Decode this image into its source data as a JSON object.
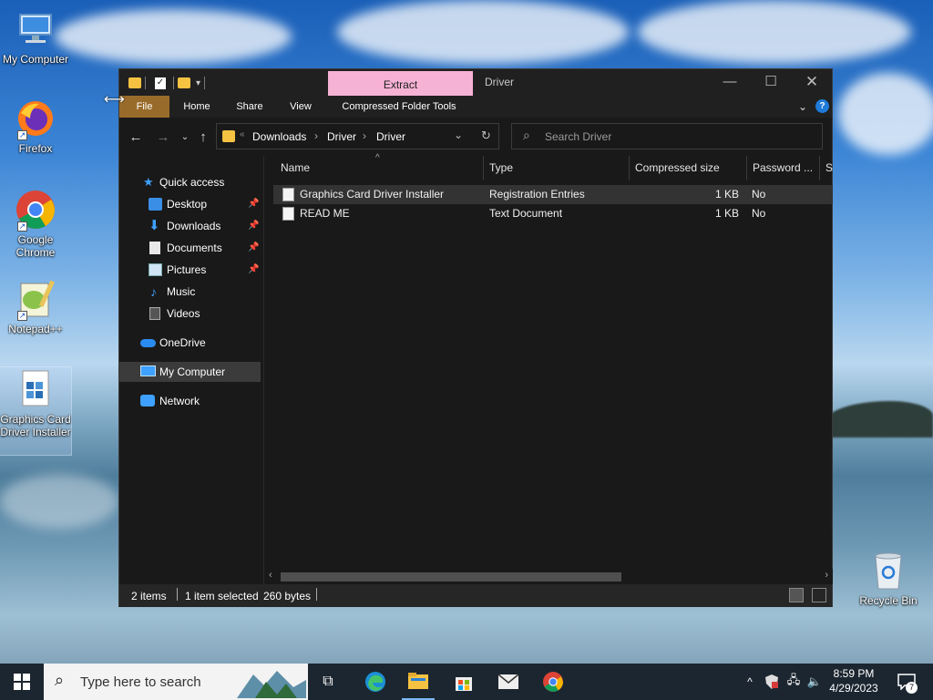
{
  "desktop": {
    "icons": [
      {
        "label": "My Computer",
        "icon": "computer-icon"
      },
      {
        "label": "Firefox",
        "icon": "firefox-icon"
      },
      {
        "label": "Google Chrome",
        "icon": "chrome-icon"
      },
      {
        "label": "Notepad++",
        "icon": "notepadpp-icon"
      },
      {
        "label": "Graphics Card Driver Installer",
        "icon": "registry-file-icon"
      },
      {
        "label": "Recycle Bin",
        "icon": "recycle-bin-icon"
      }
    ]
  },
  "window": {
    "contextual_tab": "Extract",
    "title": "Driver",
    "ribbon_tabs": [
      "File",
      "Home",
      "Share",
      "View",
      "Compressed Folder Tools"
    ],
    "address": {
      "crumbs": [
        "Downloads",
        "Driver",
        "Driver"
      ],
      "separator": "›",
      "overflow": "«"
    },
    "search_placeholder": "Search Driver",
    "sidebar": [
      {
        "label": "Quick access",
        "icon": "star-icon"
      },
      {
        "label": "Desktop",
        "icon": "desktop-folder-icon",
        "pinned": true
      },
      {
        "label": "Downloads",
        "icon": "download-arrow-icon",
        "pinned": true
      },
      {
        "label": "Documents",
        "icon": "document-icon",
        "pinned": true
      },
      {
        "label": "Pictures",
        "icon": "picture-icon",
        "pinned": true
      },
      {
        "label": "Music",
        "icon": "music-note-icon"
      },
      {
        "label": "Videos",
        "icon": "video-icon"
      },
      {
        "label": "OneDrive",
        "icon": "cloud-icon"
      },
      {
        "label": "My Computer",
        "icon": "computer-icon",
        "active": true
      },
      {
        "label": "Network",
        "icon": "network-icon"
      }
    ],
    "columns": [
      "Name",
      "Type",
      "Compressed size",
      "Password ...",
      "Si"
    ],
    "files": [
      {
        "name": "Graphics Card Driver Installer",
        "type": "Registration Entries",
        "size": "1 KB",
        "password": "No",
        "selected": true
      },
      {
        "name": "READ ME",
        "type": "Text Document",
        "size": "1 KB",
        "password": "No",
        "selected": false
      }
    ],
    "status": {
      "items": "2 items",
      "selected": "1 item selected",
      "bytes": "260 bytes"
    }
  },
  "taskbar": {
    "search_placeholder": "Type here to search",
    "time": "8:59 PM",
    "date": "4/29/2023",
    "notification_count": "7"
  },
  "colors": {
    "extract_tab": "#f6b2d4",
    "file_tab": "#996b2a",
    "window_bg": "#191919",
    "taskbar_bg": "#1c2630"
  }
}
